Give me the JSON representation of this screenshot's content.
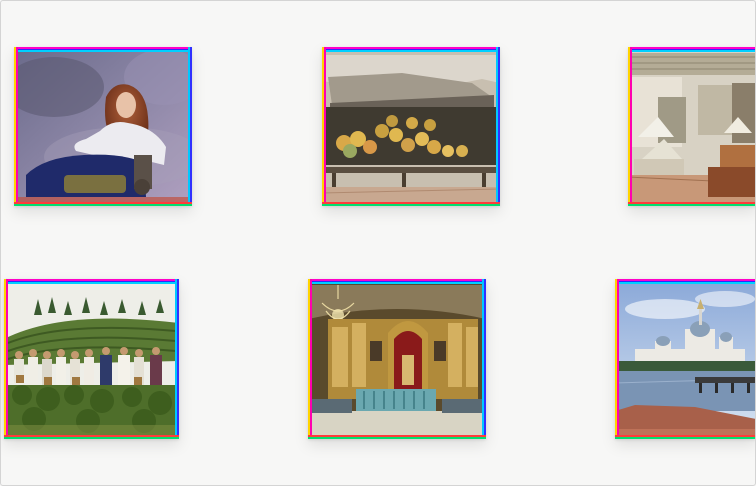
{
  "gallery": {
    "photos": [
      {
        "subject": "portrait-woman-red-hair"
      },
      {
        "subject": "melon-market-stall"
      },
      {
        "subject": "shop-interior"
      },
      {
        "subject": "tea-plantation-workers"
      },
      {
        "subject": "ornate-church-iconostasis"
      },
      {
        "subject": "monastery-by-lake"
      }
    ]
  },
  "colors": {
    "background": "#f7f7f6",
    "card_border": "#ffffff",
    "fringe_magenta": "#ff00c8",
    "fringe_cyan": "#00d0ff",
    "fringe_green": "#00e070",
    "fringe_red": "#ff3b3b"
  }
}
